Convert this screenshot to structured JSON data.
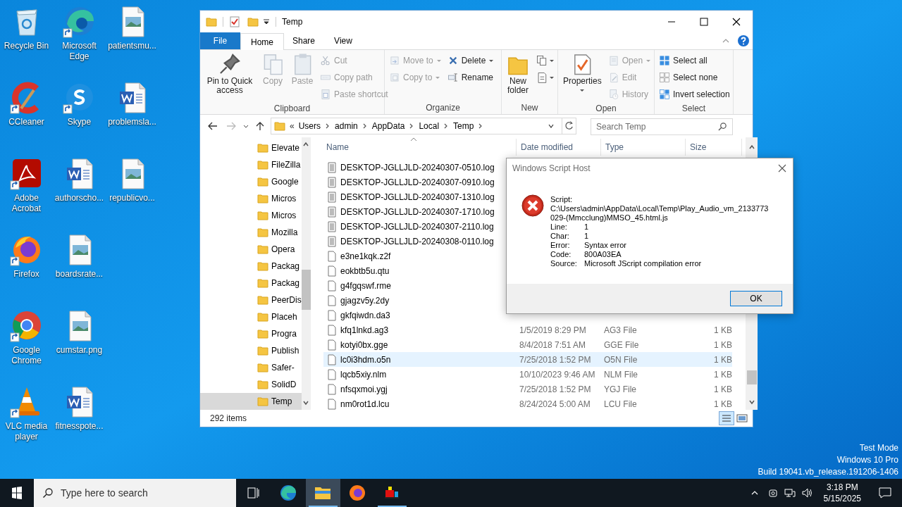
{
  "desktop": {
    "columns": [
      [
        {
          "label": "Recycle Bin",
          "kind": "recycle",
          "shortcut": false
        },
        {
          "label": "CCleaner",
          "kind": "ccleaner",
          "shortcut": true
        },
        {
          "label": "Adobe Acrobat",
          "kind": "acrobat",
          "shortcut": true
        },
        {
          "label": "Firefox",
          "kind": "firefox",
          "shortcut": true
        },
        {
          "label": "Google Chrome",
          "kind": "chrome",
          "shortcut": true
        },
        {
          "label": "VLC media player",
          "kind": "vlc",
          "shortcut": true
        }
      ],
      [
        {
          "label": "Microsoft Edge",
          "kind": "edge",
          "shortcut": true
        },
        {
          "label": "Skype",
          "kind": "skype",
          "shortcut": true
        },
        {
          "label": "authorscho...",
          "kind": "word",
          "shortcut": false
        },
        {
          "label": "boardsrate...",
          "kind": "image",
          "shortcut": false
        },
        {
          "label": "cumstar.png",
          "kind": "image",
          "shortcut": false
        },
        {
          "label": "fitnesspote...",
          "kind": "word",
          "shortcut": false
        }
      ],
      [
        {
          "label": "patientsmu...",
          "kind": "image",
          "shortcut": false
        },
        {
          "label": "problemsla...",
          "kind": "word",
          "shortcut": false
        },
        {
          "label": "republicvo...",
          "kind": "image",
          "shortcut": false
        }
      ]
    ],
    "os_notice": [
      "Test Mode",
      "Windows 10 Pro",
      "Build 19041.vb_release.191206-1406"
    ]
  },
  "explorer": {
    "title": "Temp",
    "tabs": [
      {
        "label": "File",
        "kind": "file",
        "selected": false
      },
      {
        "label": "Home",
        "kind": "tab",
        "selected": true
      },
      {
        "label": "Share",
        "kind": "tab",
        "selected": false
      },
      {
        "label": "View",
        "kind": "tab",
        "selected": false
      }
    ],
    "ribbon": [
      {
        "label": "Clipboard",
        "columns": [
          [
            {
              "label": "Pin to Quick access",
              "kind": "large",
              "disabled": false
            }
          ],
          [
            {
              "label": "Copy",
              "kind": "large",
              "disabled": true
            }
          ],
          [
            {
              "label": "Paste",
              "kind": "large",
              "disabled": true
            }
          ],
          [
            {
              "label": "Cut",
              "kind": "small",
              "disabled": true
            },
            {
              "label": "Copy path",
              "kind": "small",
              "disabled": true
            },
            {
              "label": "Paste shortcut",
              "kind": "small",
              "disabled": true
            }
          ]
        ]
      },
      {
        "label": "Organize",
        "columns": [
          [
            {
              "label": "Move to",
              "kind": "small",
              "disabled": true,
              "dropdown": true
            },
            {
              "label": "Copy to",
              "kind": "small",
              "disabled": true,
              "dropdown": true
            }
          ],
          [
            {
              "label": "Delete",
              "kind": "small",
              "disabled": false,
              "dropdown": true
            },
            {
              "label": "Rename",
              "kind": "small",
              "disabled": false
            }
          ]
        ]
      },
      {
        "label": "New",
        "columns": [
          [
            {
              "label": "New folder",
              "kind": "large",
              "disabled": false
            }
          ],
          [
            {
              "kind": "icon",
              "disabled": false,
              "dropdown": true
            },
            {
              "kind": "icon",
              "disabled": false,
              "dropdown": true
            }
          ]
        ]
      },
      {
        "label": "Open",
        "columns": [
          [
            {
              "label": "Properties",
              "kind": "large",
              "disabled": false,
              "dropdown": true
            }
          ],
          [
            {
              "label": "Open",
              "kind": "small",
              "disabled": true,
              "dropdown": true
            },
            {
              "label": "Edit",
              "kind": "small",
              "disabled": true
            },
            {
              "label": "History",
              "kind": "small",
              "disabled": true
            }
          ]
        ]
      },
      {
        "label": "Select",
        "columns": [
          [
            {
              "label": "Select all",
              "kind": "small",
              "disabled": false
            },
            {
              "label": "Select none",
              "kind": "small",
              "disabled": false
            },
            {
              "label": "Invert selection",
              "kind": "small",
              "disabled": false
            }
          ]
        ]
      }
    ],
    "address": {
      "prefix": "«",
      "crumbs": [
        "Users",
        "admin",
        "AppData",
        "Local",
        "Temp"
      ]
    },
    "search": {
      "placeholder": "Search Temp"
    },
    "nav": [
      {
        "label": "Elevate",
        "selected": false
      },
      {
        "label": "FileZilla",
        "selected": false
      },
      {
        "label": "Google",
        "selected": false
      },
      {
        "label": "Micros",
        "selected": false
      },
      {
        "label": "Micros",
        "selected": false
      },
      {
        "label": "Mozilla",
        "selected": false
      },
      {
        "label": "Opera",
        "selected": false
      },
      {
        "label": "Packag",
        "selected": false
      },
      {
        "label": "Packag",
        "selected": false
      },
      {
        "label": "PeerDis",
        "selected": false
      },
      {
        "label": "Placeh",
        "selected": false
      },
      {
        "label": "Progra",
        "selected": false
      },
      {
        "label": "Publish",
        "selected": false
      },
      {
        "label": "Safer-",
        "selected": false
      },
      {
        "label": "SolidD",
        "selected": false
      },
      {
        "label": "Temp",
        "selected": true
      }
    ],
    "columns": [
      "Name",
      "Date modified",
      "Type",
      "Size"
    ],
    "files": [
      {
        "name": "DESKTOP-JGLLJLD-20240307-0510.log",
        "kind": "log",
        "selected": false
      },
      {
        "name": "DESKTOP-JGLLJLD-20240307-0910.log",
        "kind": "log",
        "selected": false
      },
      {
        "name": "DESKTOP-JGLLJLD-20240307-1310.log",
        "kind": "log",
        "selected": false
      },
      {
        "name": "DESKTOP-JGLLJLD-20240307-1710.log",
        "kind": "log",
        "selected": false
      },
      {
        "name": "DESKTOP-JGLLJLD-20240307-2110.log",
        "kind": "log",
        "selected": false
      },
      {
        "name": "DESKTOP-JGLLJLD-20240308-0110.log",
        "kind": "log",
        "selected": false
      },
      {
        "name": "e3ne1kqk.z2f",
        "kind": "blank",
        "selected": false
      },
      {
        "name": "eokbtb5u.qtu",
        "kind": "blank",
        "selected": false
      },
      {
        "name": "g4fgqswf.rme",
        "kind": "blank",
        "selected": false
      },
      {
        "name": "gjagzv5y.2dy",
        "kind": "blank",
        "selected": false
      },
      {
        "name": "gkfqiwdn.da3",
        "kind": "blank",
        "selected": false
      },
      {
        "name": "kfq1lnkd.ag3",
        "date": "1/5/2019 8:29 PM",
        "type": "AG3 File",
        "size": "1 KB",
        "kind": "blank",
        "selected": false
      },
      {
        "name": "kotyi0bx.gge",
        "date": "8/4/2018 7:51 AM",
        "type": "GGE File",
        "size": "1 KB",
        "kind": "blank",
        "selected": false
      },
      {
        "name": "lc0i3hdm.o5n",
        "date": "7/25/2018 1:52 PM",
        "type": "O5N File",
        "size": "1 KB",
        "kind": "blank",
        "selected": true
      },
      {
        "name": "lqcb5xiy.nlm",
        "date": "10/10/2023 9:46 AM",
        "type": "NLM File",
        "size": "1 KB",
        "kind": "blank",
        "selected": false
      },
      {
        "name": "nfsqxmoi.ygj",
        "date": "7/25/2018 1:52 PM",
        "type": "YGJ File",
        "size": "1 KB",
        "kind": "blank",
        "selected": false
      },
      {
        "name": "nm0rot1d.lcu",
        "date": "8/24/2024 5:00 AM",
        "type": "LCU File",
        "size": "1 KB",
        "kind": "blank",
        "selected": false
      }
    ],
    "status": "292 items"
  },
  "dialog": {
    "title": "Windows Script Host",
    "script_label": "Script:",
    "script_path": "C:\\Users\\admin\\AppData\\Local\\Temp\\Play_Audio_vm_2133773029-(Mmcclung)MMSO_45.html.js",
    "fields": [
      {
        "label": "Line:",
        "value": "1"
      },
      {
        "label": "Char:",
        "value": "1"
      },
      {
        "label": "Error:",
        "value": "Syntax error"
      },
      {
        "label": "Code:",
        "value": "800A03EA"
      },
      {
        "label": "Source:",
        "value": "Microsoft JScript compilation error"
      }
    ],
    "button": "OK"
  },
  "taskbar": {
    "search_placeholder": "Type here to search",
    "apps": [
      {
        "kind": "taskview",
        "active": false,
        "running": false
      },
      {
        "kind": "edge",
        "active": false,
        "running": false
      },
      {
        "kind": "explorer",
        "active": true,
        "running": true
      },
      {
        "kind": "firefox",
        "active": false,
        "running": false
      },
      {
        "kind": "app",
        "active": false,
        "running": true
      }
    ],
    "time": "3:18 PM",
    "date": "5/15/2025"
  }
}
